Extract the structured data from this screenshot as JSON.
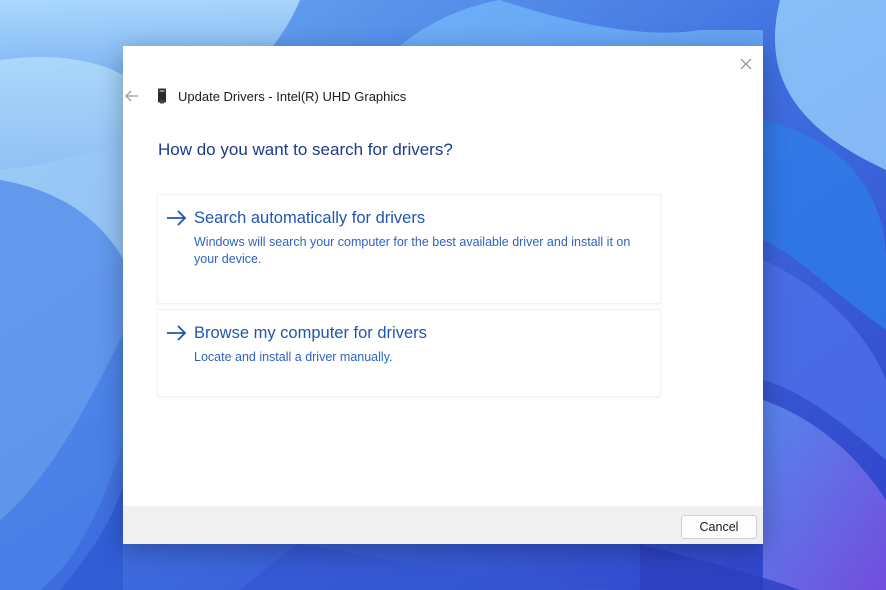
{
  "dialog": {
    "title": "Update Drivers - Intel(R) UHD Graphics",
    "question": "How do you want to search for drivers?",
    "options": [
      {
        "title": "Search automatically for drivers",
        "description": "Windows will search your computer for the best available driver and install it on your device."
      },
      {
        "title": "Browse my computer for drivers",
        "description": "Locate and install a driver manually."
      }
    ],
    "cancel_label": "Cancel"
  },
  "icons": {
    "close": "close-icon",
    "back": "back-arrow-icon",
    "device": "graphics-device-icon",
    "option_arrow": "arrow-right-icon"
  },
  "colors": {
    "accent": "#1f57b0",
    "question": "#1e3a8a",
    "description": "#2f63c4",
    "footer": "#f0f0f0"
  }
}
